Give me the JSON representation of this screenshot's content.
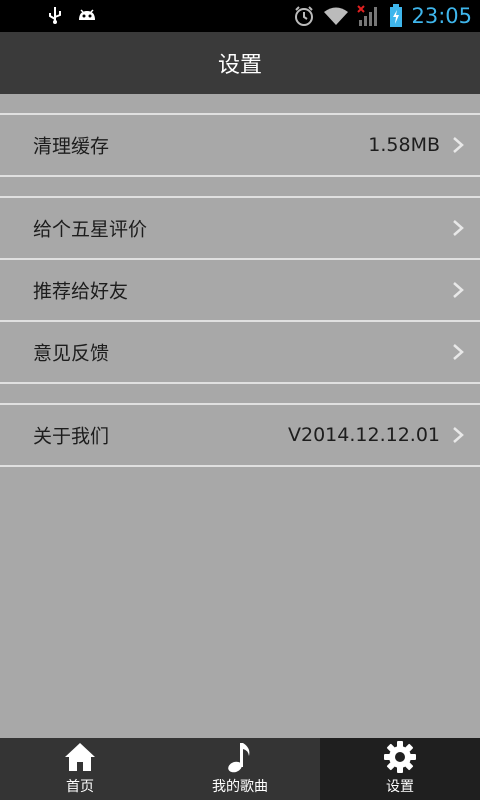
{
  "status_bar": {
    "time": "23:05",
    "left_icons": [
      "usb-icon",
      "android-icon"
    ],
    "right_icons": [
      "alarm-icon",
      "wifi-icon",
      "signal-icon",
      "battery-charging-icon"
    ]
  },
  "header": {
    "title": "设置"
  },
  "settings": {
    "clear_cache": {
      "label": "清理缓存",
      "value": "1.58MB"
    },
    "rate": {
      "label": "给个五星评价"
    },
    "recommend": {
      "label": "推荐给好友"
    },
    "feedback": {
      "label": "意见反馈"
    },
    "about": {
      "label": "关于我们",
      "value": "V2014.12.12.01"
    }
  },
  "bottom_nav": {
    "items": [
      {
        "label": "首页",
        "icon": "home-icon"
      },
      {
        "label": "我的歌曲",
        "icon": "music-note-icon"
      },
      {
        "label": "设置",
        "icon": "gear-icon",
        "active": true
      }
    ]
  },
  "colors": {
    "background": "#a8a8a8",
    "title_bar": "#3a3a3a",
    "status_bar": "#000000",
    "time": "#3fb6ec",
    "bottom_nav": "#343434",
    "bottom_nav_active": "#1f1f1f",
    "divider": "#e0e0e0"
  }
}
